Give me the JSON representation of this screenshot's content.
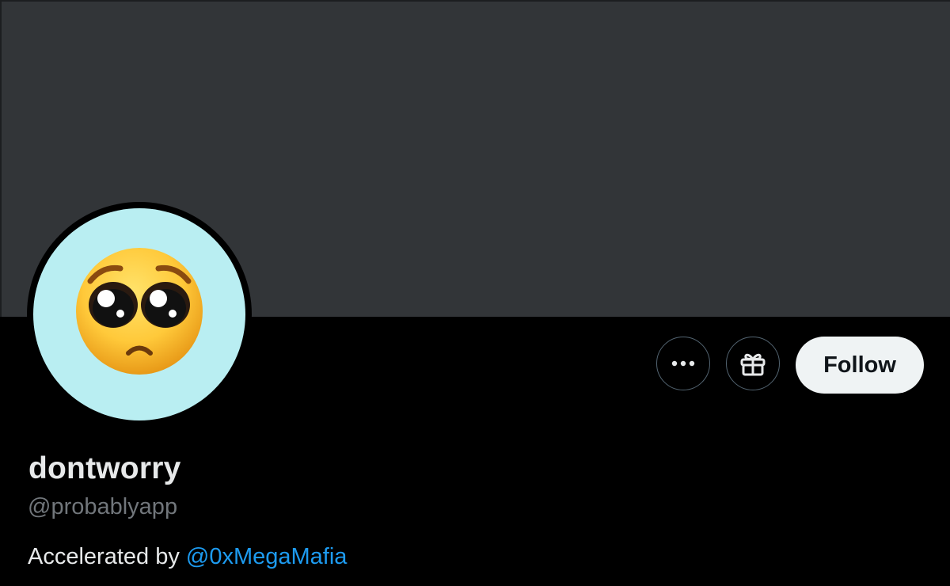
{
  "profile": {
    "display_name": "dontworry",
    "handle": "@probablyapp",
    "bio_prefix": "Accelerated by ",
    "bio_mention": "@0xMegaMafia",
    "avatar_icon": "pleading-face-emoji"
  },
  "actions": {
    "more_icon": "ellipsis-icon",
    "gift_icon": "gift-icon",
    "follow_label": "Follow"
  },
  "colors": {
    "banner": "#323538",
    "avatar_bg": "#b9eef2",
    "mention": "#1d9bf0",
    "handle": "#71767b",
    "follow_bg": "#eff3f4"
  }
}
